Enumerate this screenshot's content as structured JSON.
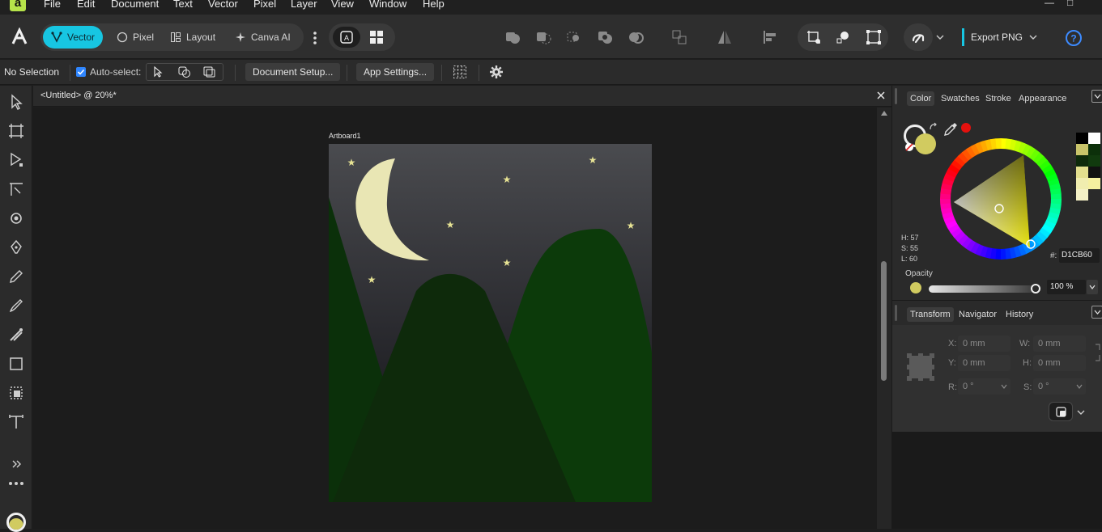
{
  "app": {
    "logo_letter": "a",
    "brand_color": "#b6e34a",
    "accent_color": "#17c6e2"
  },
  "menubar": {
    "items": [
      "File",
      "Edit",
      "Document",
      "Text",
      "Vector",
      "Pixel",
      "Layer",
      "View",
      "Window",
      "Help"
    ],
    "window_controls": [
      "—",
      "□"
    ]
  },
  "toolbar": {
    "personas": [
      {
        "label": "Vector",
        "icon": "vector-persona-icon",
        "active": true
      },
      {
        "label": "Pixel",
        "icon": "pixel-persona-icon",
        "active": false
      },
      {
        "label": "Layout",
        "icon": "layout-persona-icon",
        "active": false
      },
      {
        "label": "Canva AI",
        "icon": "canva-ai-icon",
        "active": false
      }
    ],
    "export_label": "Export PNG",
    "help_icon": "help-icon"
  },
  "context": {
    "selection_status": "No Selection",
    "auto_select_label": "Auto-select:",
    "auto_select_checked": true,
    "document_setup_label": "Document Setup...",
    "app_settings_label": "App Settings..."
  },
  "document": {
    "tab_title": "<Untitled> @ 20%*",
    "artboard_label": "Artboard1"
  },
  "color_panel": {
    "tabs": [
      "Color",
      "Swatches",
      "Stroke",
      "Appearance"
    ],
    "active_tab": "Color",
    "h_label": "H: 57",
    "s_label": "S: 55",
    "l_label": "L: 60",
    "hex_prefix": "#:",
    "hex_value": "D1CB60",
    "fill_color": "#d1cb60",
    "opacity_label": "Opacity",
    "opacity_value": "100 %"
  },
  "transform_panel": {
    "tabs": [
      "Transform",
      "Navigator",
      "History"
    ],
    "active_tab": "Transform",
    "x_label": "X:",
    "x_value": "0 mm",
    "w_label": "W:",
    "w_value": "0 mm",
    "y_label": "Y:",
    "y_value": "0 mm",
    "h_label": "H:",
    "h_value": "0 mm",
    "r_label": "R:",
    "r_value": "0 °",
    "s_label": "S:",
    "s_value": "0 °"
  },
  "artwork": {
    "sky_top": "#4a4b4f",
    "sky_bottom": "#1f1f24",
    "moon_color": "#e9e6b4",
    "star_color": "#e7e394",
    "mountain_dark": "#0e2a0b",
    "mountain_mid": "#0b300a",
    "mountain_right": "#0c3a0a"
  }
}
